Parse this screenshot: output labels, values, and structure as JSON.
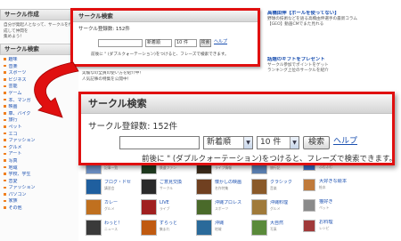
{
  "sidebar": {
    "title": "サークル作成",
    "intro": [
      "自分が発起人となって、サークルを作成して仲間を",
      "集めよう！"
    ],
    "section_title": "サークル検索",
    "categories": [
      "趣味",
      "音楽",
      "スポーツ",
      "ビジネス",
      "芸能",
      "ゲーム",
      "本、マンガ",
      "映画",
      "車、バイク",
      "旅行",
      "ペット",
      "エコ",
      "ファッション",
      "グルメ",
      "アート",
      "写真",
      "地域",
      "学校、学生",
      "恋愛",
      "ファッション",
      "パソコン",
      "家族",
      "その他"
    ]
  },
  "news": {
    "top_right_title": "高橋由伸【ボールを使ってない】",
    "top_right_lines": [
      "野球の技術などを語る高橋由伸選手の最新コラム",
      "【GEO】動画CMでまた見れる"
    ],
    "mid_right_title": "話題のギフトをプレゼント",
    "mid_right_lines": [
      "サークル参加でポイントをゲット",
      "ランキング上位のサークルを紹介"
    ],
    "mid_left_lines": [
      "実験なの全員の使い方を紹介中！",
      "人気記事の特集を公開中！"
    ]
  },
  "small_box": {
    "title": "サークル検索",
    "count": "サークル登録数: 152件",
    "sort": "新着順",
    "per_page": "10 件",
    "search_button": "検索",
    "help": "ヘルプ",
    "note": "前後に \" (ダブルクォーテーション)をつけると、フレーズで検索できます。"
  },
  "big_box": {
    "title": "サークル検索",
    "count": "サークル登録数: 152件",
    "search_placeholder": "",
    "sort": "新着順",
    "per_page": "10 件",
    "search_button": "検索",
    "help": "ヘルプ",
    "note": "前後に \" (ダブルクォーテーション)をつけると、フレーズで検索できます。"
  },
  "grid_items": [
    {
      "title": "ブログ新着",
      "sub": "記事一覧",
      "color": "#6a8cc0"
    },
    {
      "title": "鉄道カレンダー",
      "sub": "鉄道ファン",
      "color": "#1f3a1f"
    },
    {
      "title": "ステキな音楽",
      "sub": "ライブ情報",
      "color": "#3a2a1a"
    },
    {
      "title": "トラベル",
      "sub": "旅行記",
      "color": "#5a7fb0"
    },
    {
      "title": "ブログ・ドセ",
      "sub": "講習会",
      "color": "#1f5f9f"
    },
    {
      "title": "ご意見交換",
      "sub": "サークル",
      "color": "#2a2a2a"
    },
    {
      "title": "懐かしの映画",
      "sub": "名作特集",
      "color": "#704020"
    },
    {
      "title": "クラシック",
      "sub": "音楽",
      "color": "#8a5a2a"
    },
    {
      "title": "カレー",
      "sub": "グルメ",
      "color": "#c0701f"
    },
    {
      "title": "LIVE",
      "sub": "ライブ",
      "color": "#a02020"
    },
    {
      "title": "沖縄プロレス",
      "sub": "スポーツ",
      "color": "#4a6a2a"
    },
    {
      "title": "沖縄料理",
      "sub": "グルメ",
      "color": "#a07a3a"
    },
    {
      "title": "わっと！",
      "sub": "ニュース",
      "color": "#3a3a3a"
    },
    {
      "title": "ずらっと",
      "sub": "集まれ",
      "color": "#c05a10"
    },
    {
      "title": "沖縄",
      "sub": "地域",
      "color": "#2a6a9a"
    },
    {
      "title": "大自然",
      "sub": "写真",
      "color": "#5a8a3a"
    }
  ],
  "right_items": [
    {
      "title": "お話サイト",
      "sub": "ふむふむ",
      "color": "#3a6ac0"
    },
    {
      "title": "大好きな絵本",
      "sub": "絵本",
      "color": "#c07a3a"
    },
    {
      "title": "猫好き",
      "sub": "ペット",
      "color": "#8a8a8a"
    },
    {
      "title": "お料理",
      "sub": "レシピ",
      "color": "#a03a3a"
    }
  ],
  "colors": {
    "highlight_border": "#e01010",
    "link": "#1a4fb0",
    "header_gradient_top": "#f5f5f5",
    "header_gradient_bottom": "#d6d6d6"
  }
}
